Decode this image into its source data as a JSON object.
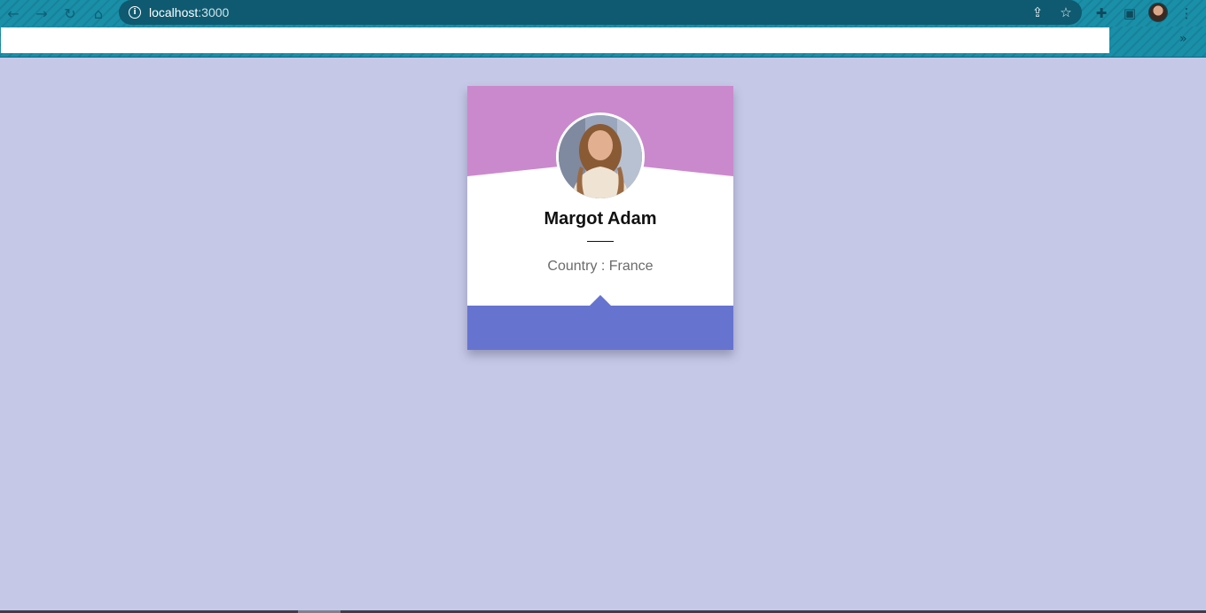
{
  "browser": {
    "url_host": "localhost",
    "url_port": ":3000",
    "nav": {
      "back_icon": "back-arrow-icon",
      "forward_icon": "forward-arrow-icon",
      "reload_icon": "reload-icon",
      "home_icon": "home-icon"
    },
    "toolbar_icons": [
      "share-icon",
      "bookmark-star-icon",
      "extensions-puzzle-icon",
      "side-panel-icon",
      "profile-avatar",
      "menu-kebab-icon"
    ],
    "bookmarks_overflow": "»"
  },
  "colors": {
    "page_background": "#c6c8e8",
    "card_header": "#cb89cd",
    "card_footer": "#6674d0",
    "chrome_accent": "#1a8fa8",
    "omnibox": "#0f5a70"
  },
  "profile_card": {
    "name": "Margot Adam",
    "country_label": "Country : France"
  }
}
